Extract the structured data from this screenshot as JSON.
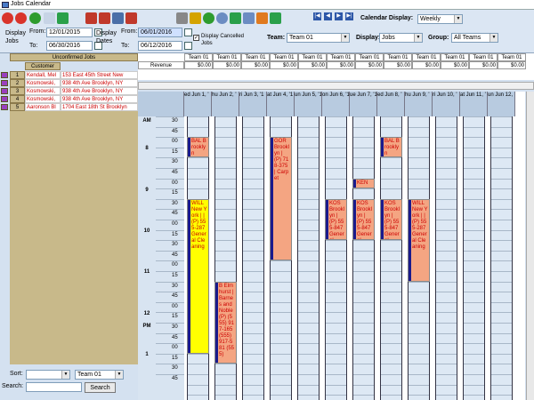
{
  "window": {
    "title": "Jobs Calendar"
  },
  "toolbar": {
    "display_jobs_label": "Display\nJobs",
    "from_label": "From:",
    "to_label": "To:",
    "jobs_from": "12/01/2015",
    "jobs_to": "06/30/2016",
    "display_dates_label": "Display\nDates",
    "dates_from": "06/01/2016",
    "dates_to": "06/12/2016",
    "display_cancelled_label": "Display Cancelled\nJobs",
    "display_cancelled_checked": "✓",
    "calendar_display_label": "Calendar Display:",
    "calendar_display_value": "Weekly",
    "team_label": "Team:",
    "team_value": "Team 01",
    "display_label": "Display:",
    "display_value": "Jobs",
    "group_label": "Group:",
    "group_value": "All Teams"
  },
  "unconfirmed": {
    "header": "Unconfirmed Jobs",
    "customer_header": "Customer",
    "rows": [
      {
        "num": "1",
        "customer": "Kendall, Mel",
        "address": "153 East 45th Street New"
      },
      {
        "num": "2",
        "customer": "Kosmowski,",
        "address": "938 4th Ave Brooklyn, NY"
      },
      {
        "num": "3",
        "customer": "Kosmowski,",
        "address": "938 4th Ave Brooklyn, NY"
      },
      {
        "num": "4",
        "customer": "Kosmowski,",
        "address": "938 4th Ave Brooklyn, NY"
      },
      {
        "num": "5",
        "customer": "Aaronson Bl",
        "address": "1704 East 18th St Brooklyn"
      }
    ]
  },
  "bottom": {
    "sort_label": "Sort:",
    "sort_value": "",
    "team_value": "Team 01",
    "search_label": "Search:",
    "search_value": "",
    "search_button": "Search"
  },
  "revenue": {
    "label": "Revenue",
    "teams": [
      "Team 01",
      "Team 01",
      "Team 01",
      "Team 01",
      "Team 01",
      "Team 01",
      "Team 01",
      "Team 01",
      "Team 01",
      "Team 01",
      "Team 01",
      "Team 01"
    ],
    "values": [
      "$0.00",
      "$0.00",
      "$0.00",
      "$0.00",
      "$0.00",
      "$0.00",
      "$0.00",
      "$0.00",
      "$0.00",
      "$0.00",
      "$0.00",
      "$0.00"
    ]
  },
  "calendar": {
    "days": [
      "ed Jun 1, '",
      "hu Jun 2, '",
      "ri Jun 3, '1",
      "at Jun 4, '1",
      "un Jun 5, '1",
      "on Jun 6, '1",
      "ue Jun 7, '1",
      "ed Jun 8, '",
      "hu Jun 9, '",
      "ri Jun 10, '",
      "at Jun 11, '",
      "un Jun 12,"
    ],
    "hours": [
      {
        "label": "AM",
        "mins": [
          "30",
          "45"
        ]
      },
      {
        "label": "8",
        "mins": [
          "00",
          "15",
          "30",
          "45"
        ]
      },
      {
        "label": "9",
        "mins": [
          "00",
          "15",
          "30",
          "45"
        ]
      },
      {
        "label": "10",
        "mins": [
          "00",
          "15",
          "30",
          "45"
        ]
      },
      {
        "label": "11",
        "mins": [
          "00",
          "15",
          "30",
          "45"
        ]
      },
      {
        "label": "12\n\nPM",
        "mins": [
          "00",
          "15",
          "30",
          "45"
        ]
      },
      {
        "label": "1",
        "mins": [
          "00",
          "15",
          "30",
          "45"
        ]
      }
    ],
    "appointments": [
      {
        "text": "BAL Brooklyn",
        "color": "#f4a582"
      },
      {
        "text": "WILL New York | | (P) 555-287 General Cleaning",
        "color": "#ffff00"
      },
      {
        "text": "B Elmhurst | Barnes and Noble (P) (555) 917-165 (555) 917-581 (555)",
        "color": "#f4a582"
      },
      {
        "text": "GOR Brooklyn | (P) 718-375 | Carpet",
        "color": "#f4a582"
      },
      {
        "text": "KOS Brooklyn | (P) 555-847 General",
        "color": "#f4a582"
      },
      {
        "text": "KEN",
        "color": "#f4a582"
      },
      {
        "text": "KOS Brooklyn | (P) 555-847 General",
        "color": "#f4a582"
      },
      {
        "text": "BAL Brooklyn",
        "color": "#f4a582"
      },
      {
        "text": "KOS Brooklyn | (P) 555-847 General",
        "color": "#f4a582"
      },
      {
        "text": "WILL New York | | (P) 555-287 General Cleaning",
        "color": "#f4a582"
      }
    ]
  }
}
